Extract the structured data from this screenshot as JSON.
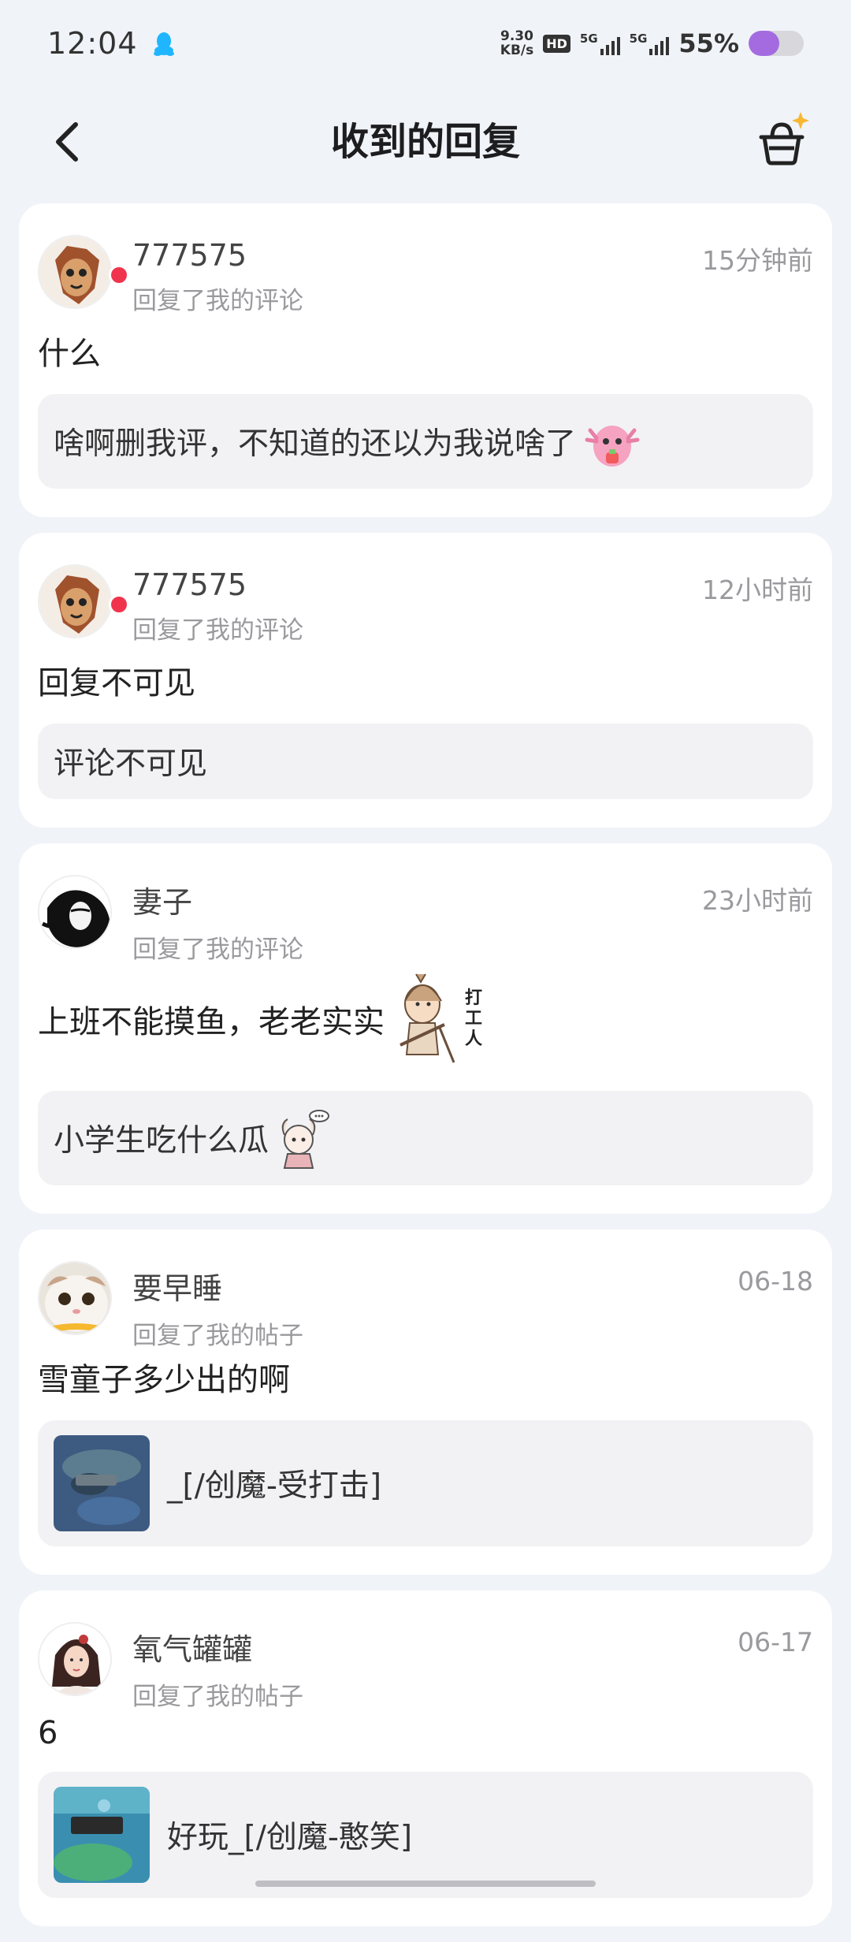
{
  "status_bar": {
    "time": "12:04",
    "net_speed_value": "9.30",
    "net_speed_unit": "KB/s",
    "hd_badge": "HD",
    "signal1_label": "5G",
    "signal2_label": "5G",
    "battery_percent": "55%",
    "battery_level": 0.55,
    "qq_icon_color": "#1fb6ff"
  },
  "header": {
    "title": "收到的回复",
    "back_icon": "chevron-left-icon",
    "basket_icon": "basket-sparkle-icon"
  },
  "replies": [
    {
      "username": "777575",
      "action": "回复了我的评论",
      "time": "15分钟前",
      "text": "什么",
      "quote": "啥啊删我评，不知道的还以为我说啥了",
      "quote_sticker": "pink-axolotl-sticker",
      "unread_dot": true
    },
    {
      "username": "777575",
      "action": "回复了我的评论",
      "time": "12小时前",
      "text": "回复不可见",
      "quote": "评论不可见",
      "unread_dot": true
    },
    {
      "username": "妻子",
      "action": "回复了我的评论",
      "time": "23小时前",
      "text": "上班不能摸鱼，老老实实",
      "text_sticker": "worker-sticker",
      "text_sticker_caption": [
        "打",
        "工",
        "人"
      ],
      "quote": "小学生吃什么瓜",
      "quote_sticker": "girl-eating-melon-sticker"
    },
    {
      "username": "要早睡",
      "action": "回复了我的帖子",
      "time": "06-18",
      "text": "雪童子多少出的啊",
      "quote": "_[/创魔-受打击]",
      "quote_thumb": "game-screenshot-thumbnail"
    },
    {
      "username": "氧气罐罐",
      "action": "回复了我的帖子",
      "time": "06-17",
      "text": "6",
      "quote": "好玩_[/创魔-憨笑]",
      "quote_thumb": "game-screenshot-thumbnail"
    }
  ],
  "colors": {
    "background": "#f0f3f8",
    "card": "#ffffff",
    "quote_bg": "#f2f2f4",
    "unread_dot": "#f0344d",
    "secondary_text": "#9a9a9e",
    "battery_fill": "#a46be0"
  }
}
